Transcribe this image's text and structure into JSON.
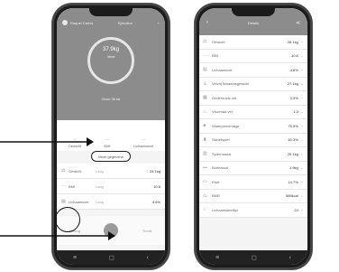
{
  "left_phone": {
    "header": {
      "user": "Raquel Carlos",
      "mode": "Ejecutivo"
    },
    "ring_value": "37.9kg",
    "ring_label": "Ideal",
    "date": "Geen 36 fat",
    "metrics": [
      {
        "label": "Gewicht",
        "value": "—"
      },
      {
        "label": "BMI",
        "value": "—"
      },
      {
        "label": "Lichaamsvet",
        "value": "—"
      }
    ],
    "more_button": "Meer gegevens",
    "rows": [
      {
        "name": "Gewicht",
        "status": "Laag",
        "value": "28.1kg"
      },
      {
        "name": "BMI",
        "status": "Laag",
        "value": "10.6"
      },
      {
        "name": "Lichaamsvet",
        "status": "Laag",
        "value": "4.6%"
      }
    ],
    "tabs": [
      "Meting",
      "",
      "Trend"
    ],
    "nav": [
      "≡",
      "◻",
      "‹"
    ]
  },
  "right_phone": {
    "title": "Details",
    "items": [
      {
        "icon": "scale-icon",
        "name": "Gewicht",
        "value": "28.1kg"
      },
      {
        "icon": "bmi-icon",
        "name": "BMI",
        "value": "10.6"
      },
      {
        "icon": "fat-icon",
        "name": "Lichaamsvet",
        "value": "4.6%"
      },
      {
        "icon": "subfat-icon",
        "name": "Vetvrij lichaamsgewicht",
        "value": "27.1kg"
      },
      {
        "icon": "subcutaneous-icon",
        "name": "Onderhuids vet",
        "value": "3.9%"
      },
      {
        "icon": "visceral-icon",
        "name": "Visceraal vet",
        "value": "1.0"
      },
      {
        "icon": "water-icon",
        "name": "Waterpercentage",
        "value": "75.5%"
      },
      {
        "icon": "muscle-icon",
        "name": "Skeletspier",
        "value": "60.3%"
      },
      {
        "icon": "musclemass-icon",
        "name": "Spiermassa",
        "value": "25.1kg"
      },
      {
        "icon": "bone-icon",
        "name": "Botmassa",
        "value": "1.9kg"
      },
      {
        "icon": "protein-icon",
        "name": "Eiwit",
        "value": "14.7%"
      },
      {
        "icon": "bmr-icon",
        "name": "BMR",
        "value": "986kcal"
      },
      {
        "icon": "age-icon",
        "name": "Lichaamsleeftijd",
        "value": "24"
      }
    ],
    "nav": [
      "≡",
      "◻",
      "‹"
    ]
  },
  "colors": {
    "header": "#8c8c8c",
    "arrow": "#111111"
  }
}
